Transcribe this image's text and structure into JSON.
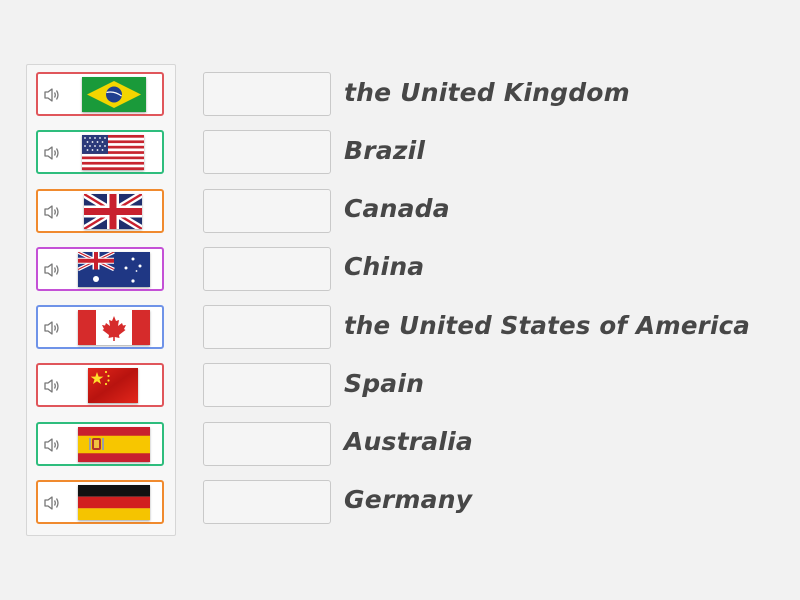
{
  "tiles": [
    {
      "flag": "flag-brazil-icon",
      "border_color": "#e0565b"
    },
    {
      "flag": "flag-usa-icon",
      "border_color": "#2ebd7d"
    },
    {
      "flag": "flag-uk-icon",
      "border_color": "#f08a2e"
    },
    {
      "flag": "flag-australia-icon",
      "border_color": "#c451d6"
    },
    {
      "flag": "flag-canada-icon",
      "border_color": "#6f93e8"
    },
    {
      "flag": "flag-china-icon",
      "border_color": "#e0565b"
    },
    {
      "flag": "flag-spain-icon",
      "border_color": "#2ebd7d"
    },
    {
      "flag": "flag-germany-icon",
      "border_color": "#f08a2e"
    }
  ],
  "labels": [
    "the United Kingdom",
    "Brazil",
    "Canada",
    "China",
    "the United States of America",
    "Spain",
    "Australia",
    "Germany"
  ]
}
